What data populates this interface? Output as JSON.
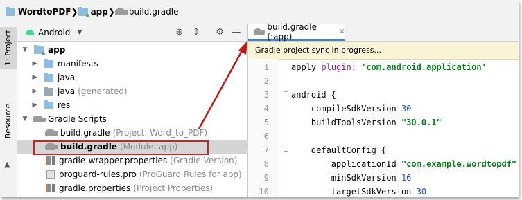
{
  "breadcrumb": {
    "items": [
      {
        "label": "WordtoPDF",
        "icon": "folder-icon"
      },
      {
        "label": "app",
        "icon": "module-folder-icon"
      },
      {
        "label": "build.gradle",
        "icon": "gradle-icon"
      }
    ]
  },
  "tool_strip": {
    "project_tab": "1: Project",
    "resource_tab": "Resource Manager"
  },
  "project_panel": {
    "view_selector": "Android",
    "tree": [
      {
        "label": "app",
        "bold": true,
        "icon": "module-folder-icon",
        "expanded": true
      },
      {
        "label": "manifests",
        "icon": "folder-icon",
        "expanded": false
      },
      {
        "label": "java",
        "icon": "folder-icon",
        "expanded": false
      },
      {
        "label": "java",
        "suffix": "(generated)",
        "icon": "generated-folder-icon",
        "expanded": false
      },
      {
        "label": "res",
        "icon": "res-folder-icon",
        "expanded": false
      },
      {
        "label": "Gradle Scripts",
        "icon": "gradle-icon",
        "expanded": true
      },
      {
        "label": "build.gradle",
        "suffix": "(Project: Word_to_PDF)",
        "icon": "gradle-icon"
      },
      {
        "label": "build.gradle",
        "suffix": "(Module: app)",
        "icon": "gradle-icon",
        "selected": true
      },
      {
        "label": "gradle-wrapper.properties",
        "suffix": "(Gradle Version)",
        "icon": "properties-icon"
      },
      {
        "label": "proguard-rules.pro",
        "suffix": "(ProGuard Rules for app)",
        "icon": "file-icon"
      },
      {
        "label": "gradle.properties",
        "suffix": "(Project Properties)",
        "icon": "properties-icon"
      }
    ]
  },
  "editor": {
    "tab_label": "build.gradle (:app)",
    "notice": "Gradle project sync in progress...",
    "lines": [
      {
        "n": "1",
        "parts": [
          [
            "apply ",
            "kw"
          ],
          [
            "plugin",
            "pl"
          ],
          [
            ": ",
            "kw"
          ],
          [
            "'com.android.application'",
            "str"
          ]
        ]
      },
      {
        "n": "2",
        "parts": []
      },
      {
        "n": "3",
        "parts": [
          [
            "android {",
            "kw"
          ]
        ]
      },
      {
        "n": "4",
        "parts": [
          [
            "    compileSdkVersion ",
            "kw"
          ],
          [
            "30",
            "num"
          ]
        ]
      },
      {
        "n": "5",
        "parts": [
          [
            "    buildToolsVersion ",
            "kw"
          ],
          [
            "\"30.0.1\"",
            "str"
          ]
        ]
      },
      {
        "n": "6",
        "parts": []
      },
      {
        "n": "7",
        "parts": [
          [
            "    defaultConfig {",
            "kw"
          ]
        ]
      },
      {
        "n": "8",
        "parts": [
          [
            "        applicationId ",
            "kw"
          ],
          [
            "\"com.example.wordtopdf\"",
            "str"
          ]
        ]
      },
      {
        "n": "9",
        "parts": [
          [
            "        minSdkVersion ",
            "kw"
          ],
          [
            "16",
            "num"
          ]
        ]
      },
      {
        "n": "10",
        "parts": [
          [
            "        targetSdkVersion ",
            "kw"
          ],
          [
            "30",
            "num"
          ]
        ]
      }
    ]
  },
  "colors": {
    "highlight_box": "#cc2222",
    "arrow": "#c01818",
    "string": "#067d17",
    "number": "#1750eb"
  }
}
